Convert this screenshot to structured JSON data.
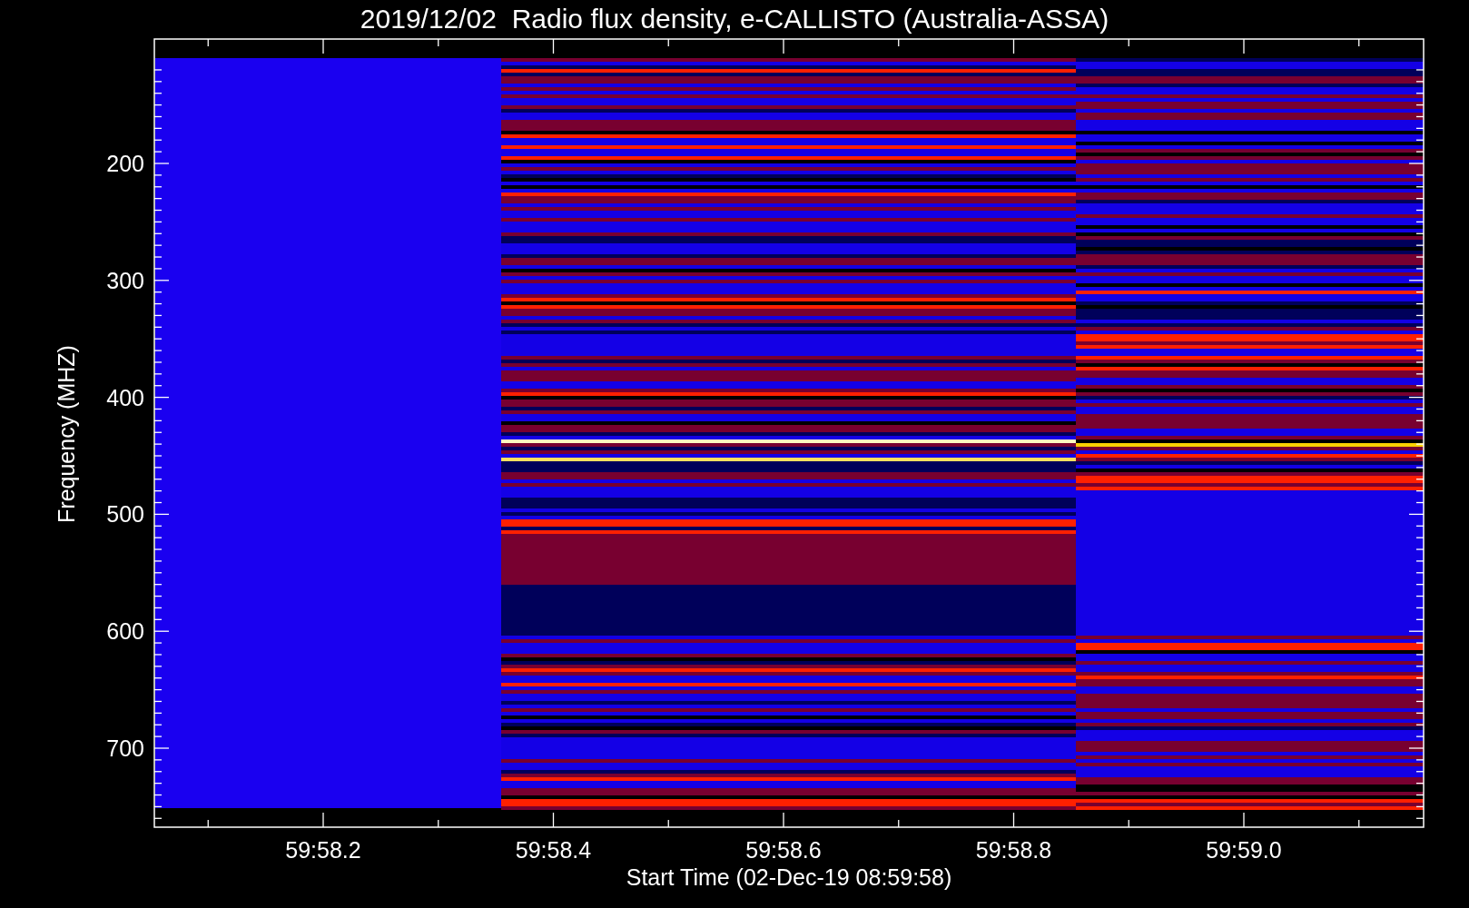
{
  "title": "2019/12/02  Radio flux density, e-CALLISTO (Australia-ASSA)",
  "y_axis": {
    "title": "Frequency (MHZ)",
    "tick_labels": [
      "200",
      "300",
      "400",
      "500",
      "600",
      "700"
    ]
  },
  "x_axis": {
    "title": "Start Time (02-Dec-19 08:59:58)",
    "tick_labels": [
      "59:58.2",
      "59:58.4",
      "59:58.6",
      "59:58.8",
      "59:59.0"
    ]
  }
}
